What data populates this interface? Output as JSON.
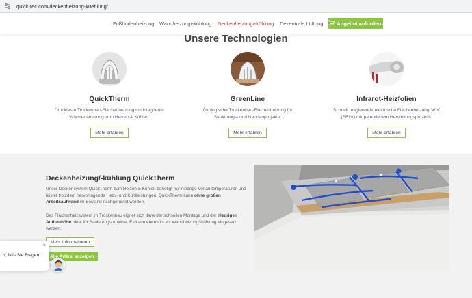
{
  "browser": {
    "url": "quick-tec.com/deckenheizung-kuehlung/"
  },
  "nav": {
    "items": [
      {
        "label": "Fußbodenheizung",
        "active": false
      },
      {
        "label": "Wandheizung/-kühlung",
        "active": false
      },
      {
        "label": "Deckenheizung/-kühlung",
        "active": true
      },
      {
        "label": "Dezentrale Lüftung",
        "active": false
      }
    ],
    "cta_label": "Angebot anfordern"
  },
  "technologies": {
    "title": "Unsere Technologien",
    "cards": [
      {
        "name": "QuickTherm",
        "text": "Druckfeste Trockenbau-Flächenheizung mit integrierter Wärmedämmung zum Heizen & Kühlen.",
        "button": "Mehr erfahren"
      },
      {
        "name": "GreenLine",
        "text": "Ökologische Trockenbau-Flächenheizung für Sanierungs- und Neubauprojekte.",
        "button": "Mehr erfahren"
      },
      {
        "name": "Infrarot-Heizfolien",
        "text": "Schnell reagierende elektrische Flächenheizung 36 V (SELV) mit patentiertem Herstellungsprozess.",
        "button": "Mehr erfahren"
      }
    ]
  },
  "feature": {
    "title": "Deckenheizung/-kühlung QuickTherm",
    "p1_a": "Unser Deckensystem QuickTherm zum Heizen & Kühlen benötigt nur niedrige Vorlauftemperaturen und leistet trotzdem hervorragende Heiz/- und Kühlleistungen. QuickTherm kann ",
    "p1_bold": "ohne großen Arbeitsaufwand",
    "p1_b": " im Bestand nachgerüstet werden.",
    "p2_a": "Das Flächenheizsystem im Trockenbau eignet sich dank der schnellen Montage und der ",
    "p2_bold": "niedrigen Aufbauhöhe",
    "p2_b": " ideal für Sanierungsprojekte.  Es kann ebenfalls als Wandheizung/-kühlung eingesetzt werden.",
    "btn_info": "Mehr Informationen",
    "btn_all": "Alle Artikel anzeigen"
  },
  "chat": {
    "message": "h, falls Sie Fragen",
    "close": "×"
  },
  "colors": {
    "accent": "#8cc63f",
    "active_nav": "#c0392b",
    "pipe": "#1f4fd1"
  }
}
